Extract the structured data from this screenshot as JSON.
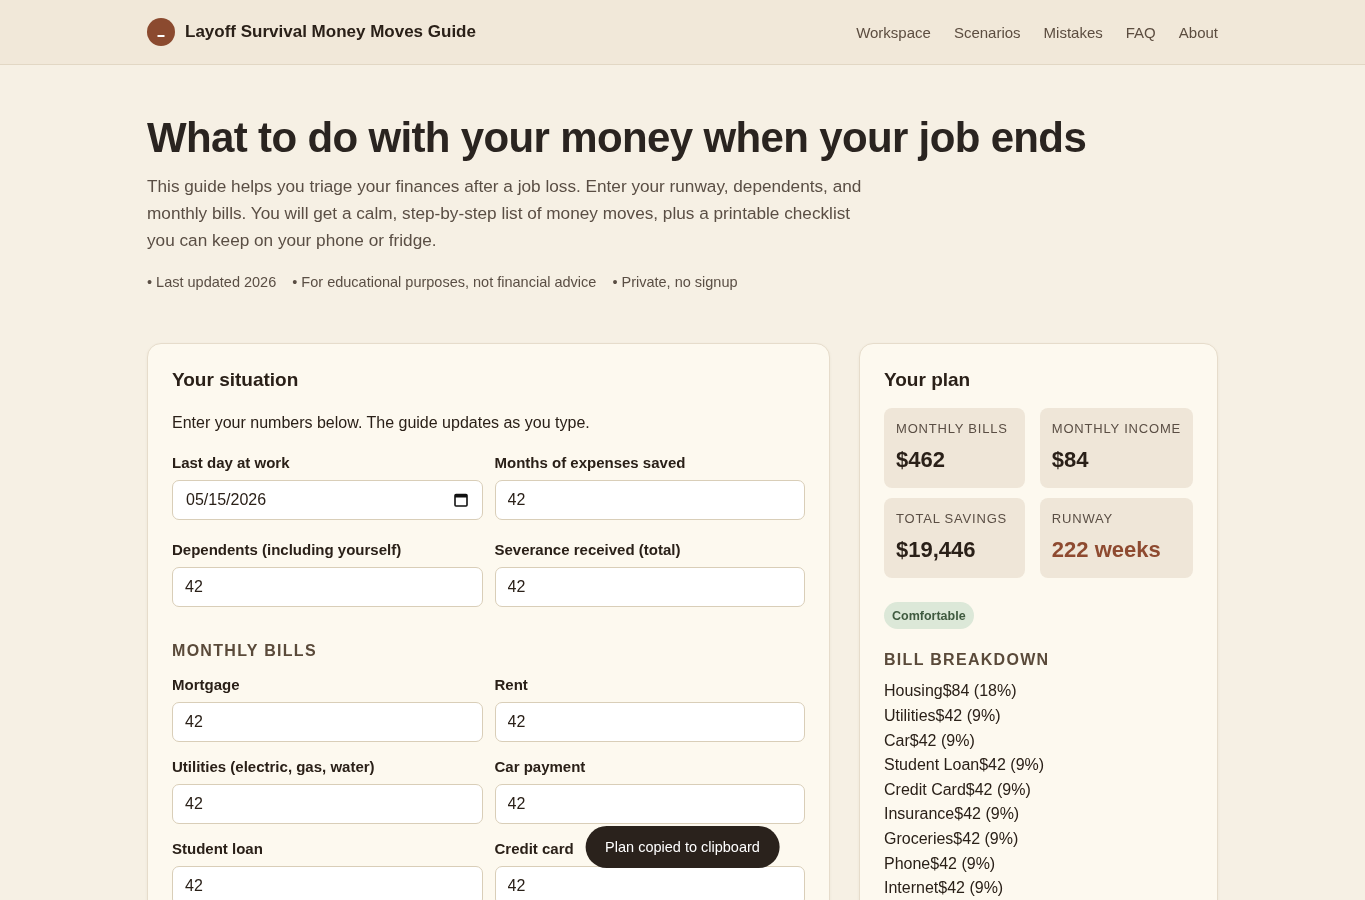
{
  "header": {
    "brand": "Layoff Survival Money Moves Guide",
    "nav": [
      "Workspace",
      "Scenarios",
      "Mistakes",
      "FAQ",
      "About"
    ]
  },
  "hero": {
    "title": "What to do with your money when your job ends",
    "intro": "This guide helps you triage your finances after a job loss. Enter your runway, dependents, and monthly bills. You will get a calm, step-by-step list of money moves, plus a printable checklist you can keep on your phone or fridge.",
    "meta": [
      "• Last updated 2026",
      "• For educational purposes, not financial advice",
      "• Private, no signup"
    ]
  },
  "situation": {
    "title": "Your situation",
    "intro": "Enter your numbers below. The guide updates as you type.",
    "fields": [
      {
        "label": "Last day at work",
        "value": "05/15/2026",
        "kind": "date"
      },
      {
        "label": "Months of expenses saved",
        "value": "42",
        "kind": "number"
      },
      {
        "label": "Dependents (including yourself)",
        "value": "42",
        "kind": "number"
      },
      {
        "label": "Severance received (total)",
        "value": "42",
        "kind": "number"
      }
    ],
    "bills_heading": "MONTHLY BILLS",
    "bills": [
      {
        "label": "Mortgage",
        "value": "42"
      },
      {
        "label": "Rent",
        "value": "42"
      },
      {
        "label": "Utilities (electric, gas, water)",
        "value": "42"
      },
      {
        "label": "Car payment",
        "value": "42"
      },
      {
        "label": "Student loan",
        "value": "42"
      },
      {
        "label": "Credit card",
        "value": "42"
      }
    ]
  },
  "plan": {
    "title": "Your plan",
    "stats": [
      {
        "label": "MONTHLY BILLS",
        "value": "$462",
        "highlighted": false
      },
      {
        "label": "MONTHLY INCOME",
        "value": "$84",
        "highlighted": false
      },
      {
        "label": "TOTAL SAVINGS",
        "value": "$19,446",
        "highlighted": false
      },
      {
        "label": "RUNWAY",
        "value": "222 weeks",
        "highlighted": true
      }
    ],
    "status": {
      "label": "Comfortable",
      "kind": "good"
    },
    "breakdown_heading": "BILL BREAKDOWN",
    "breakdown": [
      {
        "name": "Housing",
        "amount": "$84 (18%)"
      },
      {
        "name": "Utilities",
        "amount": "$42 (9%)"
      },
      {
        "name": "Car",
        "amount": "$42 (9%)"
      },
      {
        "name": "Student Loan",
        "amount": "$42 (9%)"
      },
      {
        "name": "Credit Card",
        "amount": "$42 (9%)"
      },
      {
        "name": "Insurance",
        "amount": "$42 (9%)"
      },
      {
        "name": "Groceries",
        "amount": "$42 (9%)"
      },
      {
        "name": "Phone",
        "amount": "$42 (9%)"
      },
      {
        "name": "Internet",
        "amount": "$42 (9%)"
      }
    ]
  },
  "toast": {
    "message": "Plan copied to clipboard"
  }
}
